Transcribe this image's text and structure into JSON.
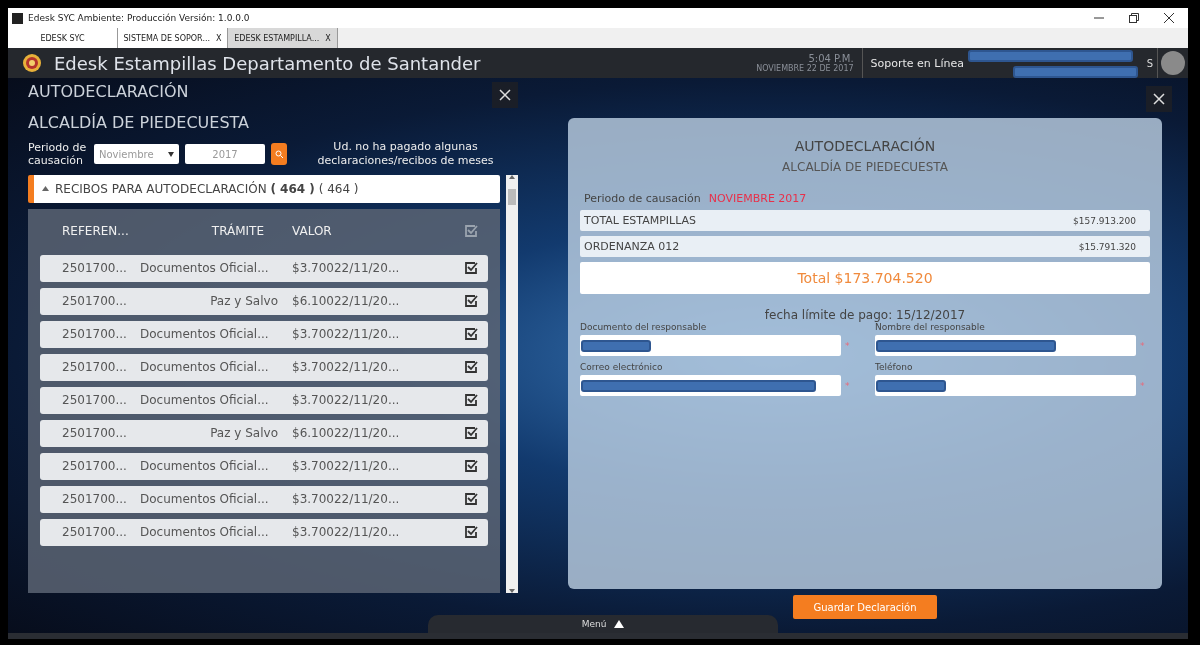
{
  "window": {
    "title": "Edesk SYC Ambiente: Producción  Versión: 1.0.0.0"
  },
  "tabs": [
    {
      "label": "EDESK SYC",
      "selected": false
    },
    {
      "label": "SISTEMA DE SOPOR...",
      "selected": false,
      "close": "X"
    },
    {
      "label": "EDESK ESTAMPILLA...",
      "selected": true,
      "close": "X"
    }
  ],
  "header": {
    "title": "Edesk Estampillas Departamento de Santander",
    "time": "5:04 P.M.",
    "date": "NOVIEMBRE 22 DE 2017",
    "support": "Soporte en Línea",
    "user_initial": "S"
  },
  "left": {
    "title": "AUTODECLARACIÓN",
    "subtitle": "ALCALDÍA DE PIEDECUESTA",
    "period_label": "Periodo de causación",
    "month": "Noviembre",
    "year": "2017",
    "notice": "Ud. no ha pagado algunas declaraciones/recibos de meses",
    "section": {
      "label": "RECIBOS PARA AUTODECLARACIÓN",
      "count_bold": "( 464 )",
      "count": "( 464 )",
      "expanded": true
    },
    "columns": [
      "REFEREN...",
      "TRÁMITE",
      "VALOR"
    ],
    "rows": [
      {
        "ref": "2501700...",
        "tramite": "Documentos Oficial...",
        "valor": "$3.70022/11/20...",
        "checked": true
      },
      {
        "ref": "2501700...",
        "tramite": "Paz y Salvo",
        "valor": "$6.10022/11/20...",
        "checked": true
      },
      {
        "ref": "2501700...",
        "tramite": "Documentos Oficial...",
        "valor": "$3.70022/11/20...",
        "checked": true
      },
      {
        "ref": "2501700...",
        "tramite": "Documentos Oficial...",
        "valor": "$3.70022/11/20...",
        "checked": true
      },
      {
        "ref": "2501700...",
        "tramite": "Documentos Oficial...",
        "valor": "$3.70022/11/20...",
        "checked": true
      },
      {
        "ref": "2501700...",
        "tramite": "Paz y Salvo",
        "valor": "$6.10022/11/20...",
        "checked": true
      },
      {
        "ref": "2501700...",
        "tramite": "Documentos Oficial...",
        "valor": "$3.70022/11/20...",
        "checked": true
      },
      {
        "ref": "2501700...",
        "tramite": "Documentos Oficial...",
        "valor": "$3.70022/11/20...",
        "checked": true
      },
      {
        "ref": "2501700...",
        "tramite": "Documentos Oficial...",
        "valor": "$3.70022/11/20...",
        "checked": true
      }
    ]
  },
  "right": {
    "title": "AUTODECLARACIÓN",
    "subtitle": "ALCALDÍA DE PIEDECUESTA",
    "period_label": "Periodo de causación",
    "period": "NOVIEMBRE 2017",
    "lines": [
      {
        "label": "TOTAL ESTAMPILLAS",
        "amount": "$157.913.200"
      },
      {
        "label": "ORDENANZA 012",
        "amount": "$15.791.320"
      }
    ],
    "total": "Total $173.704.520",
    "deadline": "fecha límite de pago: 15/12/2017",
    "fields": [
      {
        "label": "Documento del responsable",
        "required": true
      },
      {
        "label": "Nombre del responsable",
        "required": true
      },
      {
        "label": "Correo electrónico",
        "required": true
      },
      {
        "label": "Teléfono",
        "required": true
      }
    ],
    "required_mark": "*",
    "save": "Guardar Declaración"
  },
  "menu": {
    "label": "Menú"
  }
}
